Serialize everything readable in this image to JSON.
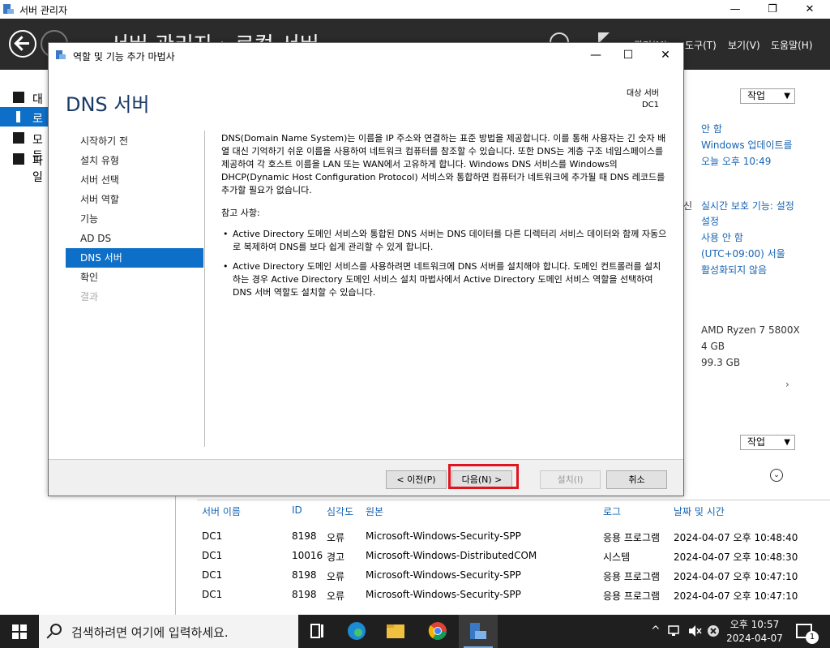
{
  "outer_window": {
    "title": "서버 관리자",
    "breadcrumb": "서버 관리자 › 로컬 서버",
    "menus": [
      "관리(M)",
      "도구(T)",
      "보기(V)",
      "도움말(H)"
    ],
    "min_glyph": "—",
    "max_glyph": "❐",
    "close_glyph": "✕"
  },
  "left_nav": [
    {
      "label": "대시"
    },
    {
      "label": "로컬"
    },
    {
      "label": "모든"
    },
    {
      "label": "파일"
    }
  ],
  "right_panel": {
    "task_label": "작업",
    "lines_top": [
      "안 함",
      "Windows 업데이트를",
      "오늘 오후 10:49"
    ],
    "lines_mid": [
      "실시간 보호 기능: 설정",
      "설정",
      "사용 안 함",
      "(UTC+09:00) 서울",
      "활성화되지 않음"
    ],
    "mid_prefix": "신",
    "lines_hw": [
      "AMD Ryzen 7 5800X",
      "4 GB",
      "99.3 GB"
    ],
    "scroll_arrow": "›",
    "events_task_label": "작업",
    "events_toggle": "⌄"
  },
  "events": {
    "headers": [
      "서버 이름",
      "ID",
      "심각도",
      "원본",
      "로그",
      "날짜 및 시간"
    ],
    "rows": [
      [
        "DC1",
        "8198",
        "오류",
        "Microsoft-Windows-Security-SPP",
        "응용 프로그램",
        "2024-04-07 오후 10:48:40"
      ],
      [
        "DC1",
        "10016",
        "경고",
        "Microsoft-Windows-DistributedCOM",
        "시스템",
        "2024-04-07 오후 10:48:30"
      ],
      [
        "DC1",
        "8198",
        "오류",
        "Microsoft-Windows-Security-SPP",
        "응용 프로그램",
        "2024-04-07 오후 10:47:10"
      ],
      [
        "DC1",
        "8198",
        "오류",
        "Microsoft-Windows-Security-SPP",
        "응용 프로그램",
        "2024-04-07 오후 10:47:10"
      ]
    ]
  },
  "dialog": {
    "title": "역할 및 기능 추가 마법사",
    "heading": "DNS 서버",
    "target_label": "대상 서버",
    "target_server": "DC1",
    "min_glyph": "—",
    "max_glyph": "☐",
    "close_glyph": "✕",
    "nav": [
      {
        "label": "시작하기 전"
      },
      {
        "label": "설치 유형"
      },
      {
        "label": "서버 선택"
      },
      {
        "label": "서버 역할"
      },
      {
        "label": "기능"
      },
      {
        "label": "AD DS"
      },
      {
        "label": "DNS 서버"
      },
      {
        "label": "확인"
      },
      {
        "label": "결과"
      }
    ],
    "intro": "DNS(Domain Name System)는 이름을 IP 주소와 연결하는 표준 방법을 제공합니다. 이를 통해 사용자는 긴 숫자 배열 대신 기억하기 쉬운 이름을 사용하여 네트워크 컴퓨터를 참조할 수 있습니다. 또한 DNS는 계층 구조 네임스페이스를 제공하여 각 호스트 이름을 LAN 또는 WAN에서 고유하게 합니다. Windows DNS 서비스를 Windows의 DHCP(Dynamic Host Configuration Protocol) 서비스와 통합하면 컴퓨터가 네트워크에 추가될 때 DNS 레코드를 추가할 필요가 없습니다.",
    "notes_title": "참고 사항:",
    "notes": [
      "Active Directory 도메인 서비스와 통합된 DNS 서버는 DNS 데이터를 다른 디렉터리 서비스 데이터와 함께 자동으로 복제하여 DNS를 보다 쉽게 관리할 수 있게 합니다.",
      "Active Directory 도메인 서비스를 사용하려면 네트워크에 DNS 서버를 설치해야 합니다. 도메인 컨트롤러를 설치하는 경우 Active Directory 도메인 서비스 설치 마법사에서 Active Directory 도메인 서비스 역할을 선택하여 DNS 서버 역할도 설치할 수 있습니다."
    ],
    "buttons": {
      "prev": "< 이전(P)",
      "next": "다음(N) >",
      "install": "설치(I)",
      "cancel": "취소"
    }
  },
  "taskbar": {
    "search_placeholder": "검색하려면 여기에 입력하세요.",
    "tray_caret": "^",
    "time": "오후 10:57",
    "date": "2024-04-07",
    "notif_count": "1"
  }
}
